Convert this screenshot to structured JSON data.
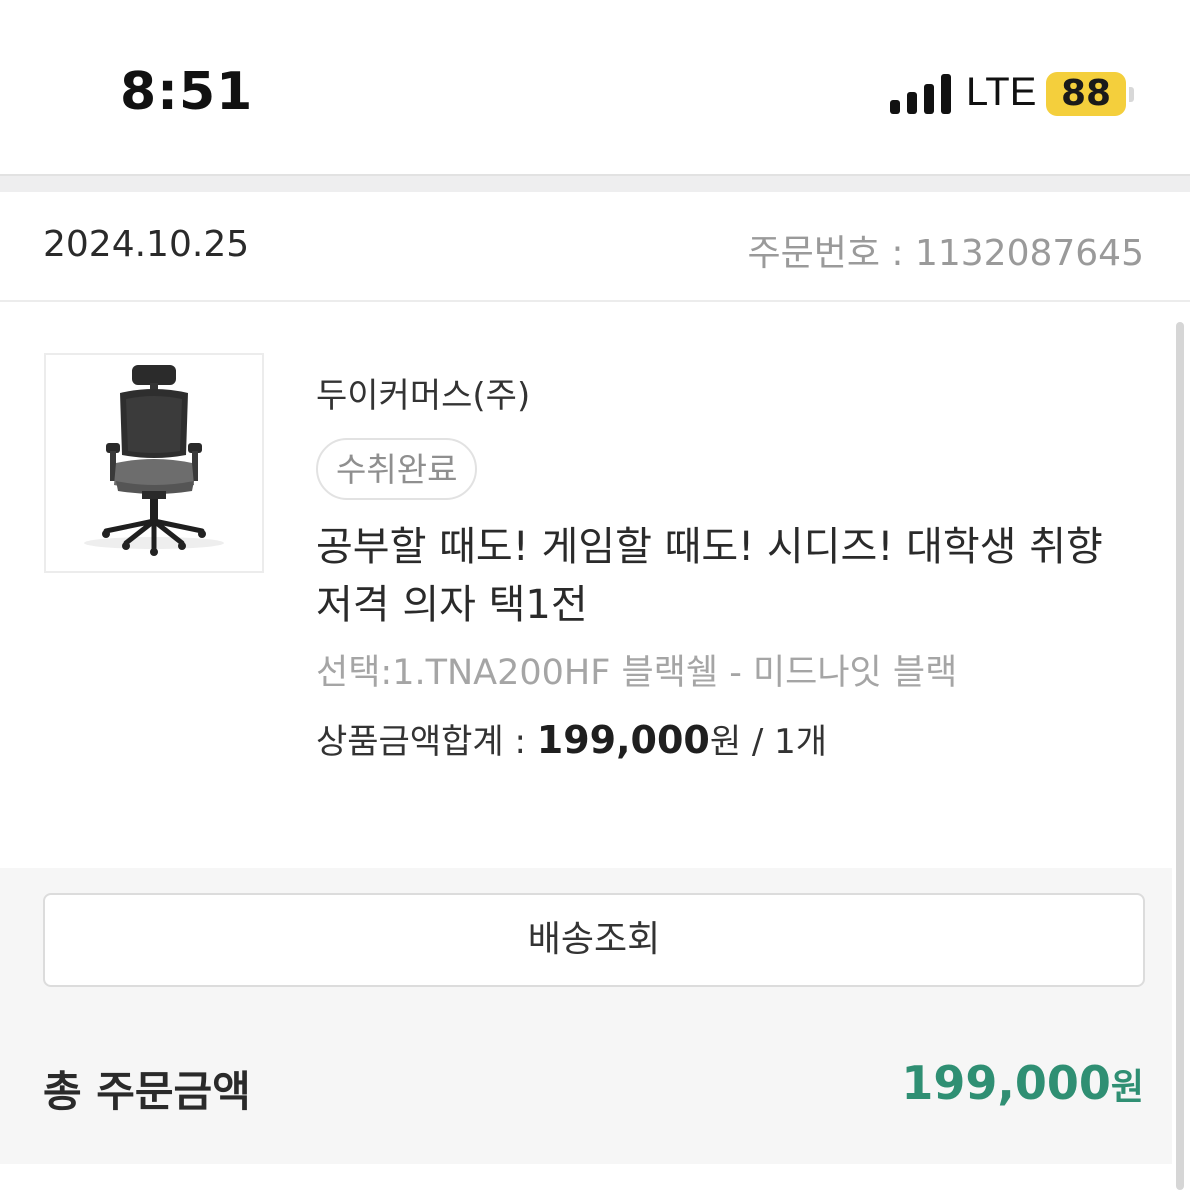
{
  "status_bar": {
    "time": "8:51",
    "network": "LTE",
    "battery": "88",
    "battery_color": "#f4cf3c",
    "signal_icon": "signal-bars-icon"
  },
  "order": {
    "date": "2024.10.25",
    "number_label": "주문번호 : 1132087645"
  },
  "product": {
    "image_icon": "office-chair-image",
    "seller": "두이커머스(주)",
    "status": "수취완료",
    "title": "공부할 때도! 게임할 때도! 시디즈! 대학생 취향 저격 의자 택1전",
    "option": "선택:1.TNA200HF 블랙쉘 - 미드나잇 블랙",
    "price_label": "상품금액합계 : ",
    "price_value": "199,000",
    "price_unit": "원",
    "quantity": " / 1개"
  },
  "actions": {
    "delivery_button": "배송조회"
  },
  "total": {
    "label": "총 주문금액",
    "value": "199,000",
    "unit": "원",
    "accent_color": "#2f8f73"
  }
}
